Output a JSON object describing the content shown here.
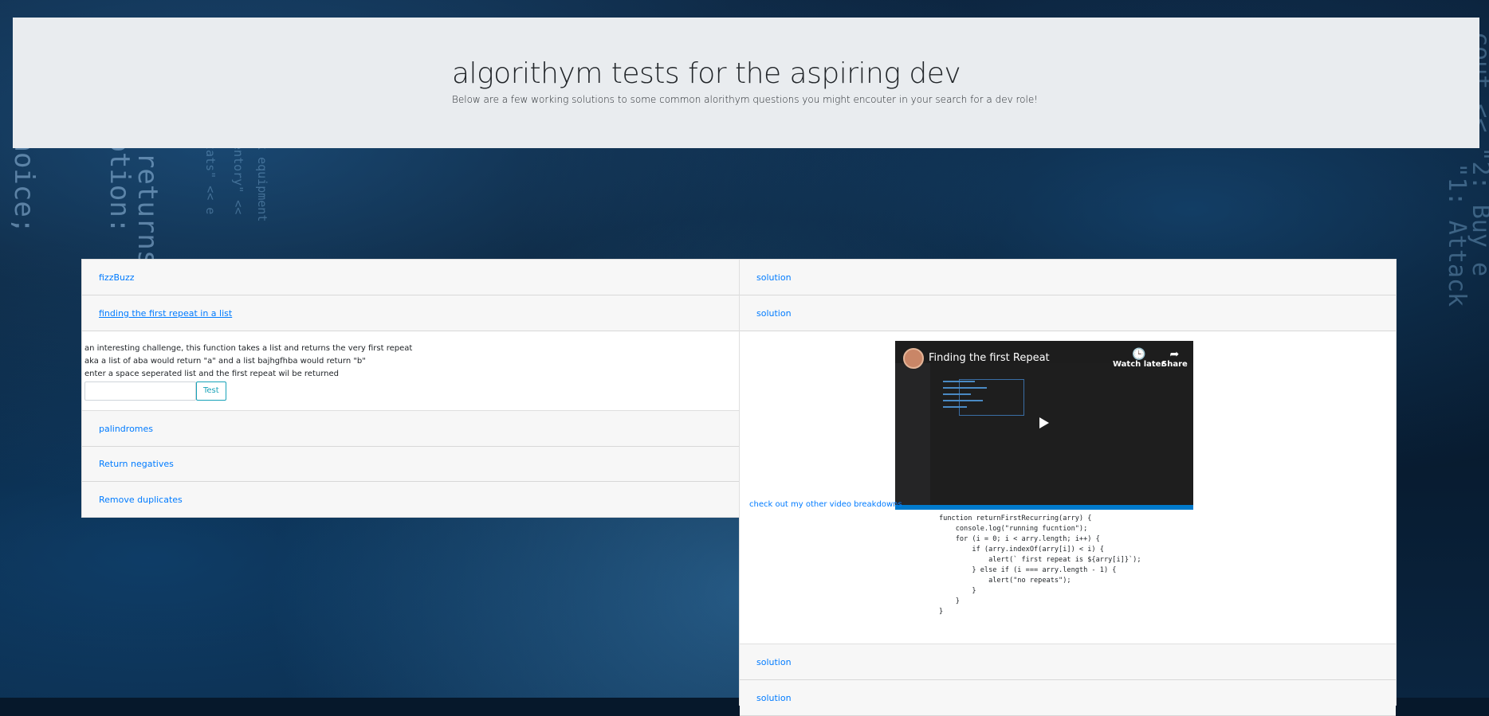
{
  "header": {
    "title": "algorithym tests for the aspiring dev",
    "subtitle": "Below are a few working solutions to some common alorithym questions you might encouter in your search for a dev role!"
  },
  "left_accordion": {
    "items": [
      {
        "label": "fizzBuzz"
      },
      {
        "label": "finding the first repeat in a list"
      },
      {
        "label": "palindromes"
      },
      {
        "label": "Return negatives"
      },
      {
        "label": "Remove duplicates"
      }
    ],
    "open_item": {
      "line1": "an interesting challenge, this function takes a list and returns the very first repeat",
      "line2": "aka a list of aba would return \"a\" and a list bajhgfhba would return \"b\"",
      "line3": "enter a space seperated list and the first repeat wil be returned",
      "input_value": "",
      "button_label": "Test"
    }
  },
  "right_accordion": {
    "items": [
      {
        "label": "solution"
      },
      {
        "label": "solution"
      },
      {
        "label": "solution"
      },
      {
        "label": "solution"
      }
    ],
    "video": {
      "title": "Finding the first Repeat",
      "watch_later": "Watch later",
      "share": "Share",
      "link_text": "check out my other video breakdowns"
    },
    "code": "function returnFirstRecurring(arry) {\n    console.log(\"running fucntion\");\n    for (i = 0; i < arry.length; i++) {\n        if (arry.indexOf(arry[i]) < i) {\n            alert(` first repeat is ${arry[i]}`);\n        } else if (i === arry.length - 1) {\n            alert(\"no repeats\");\n        }\n    }\n}"
  },
  "colors": {
    "link": "#007bff",
    "jumbotron_bg": "#e9ecef",
    "test_button": "#17a2b8"
  }
}
